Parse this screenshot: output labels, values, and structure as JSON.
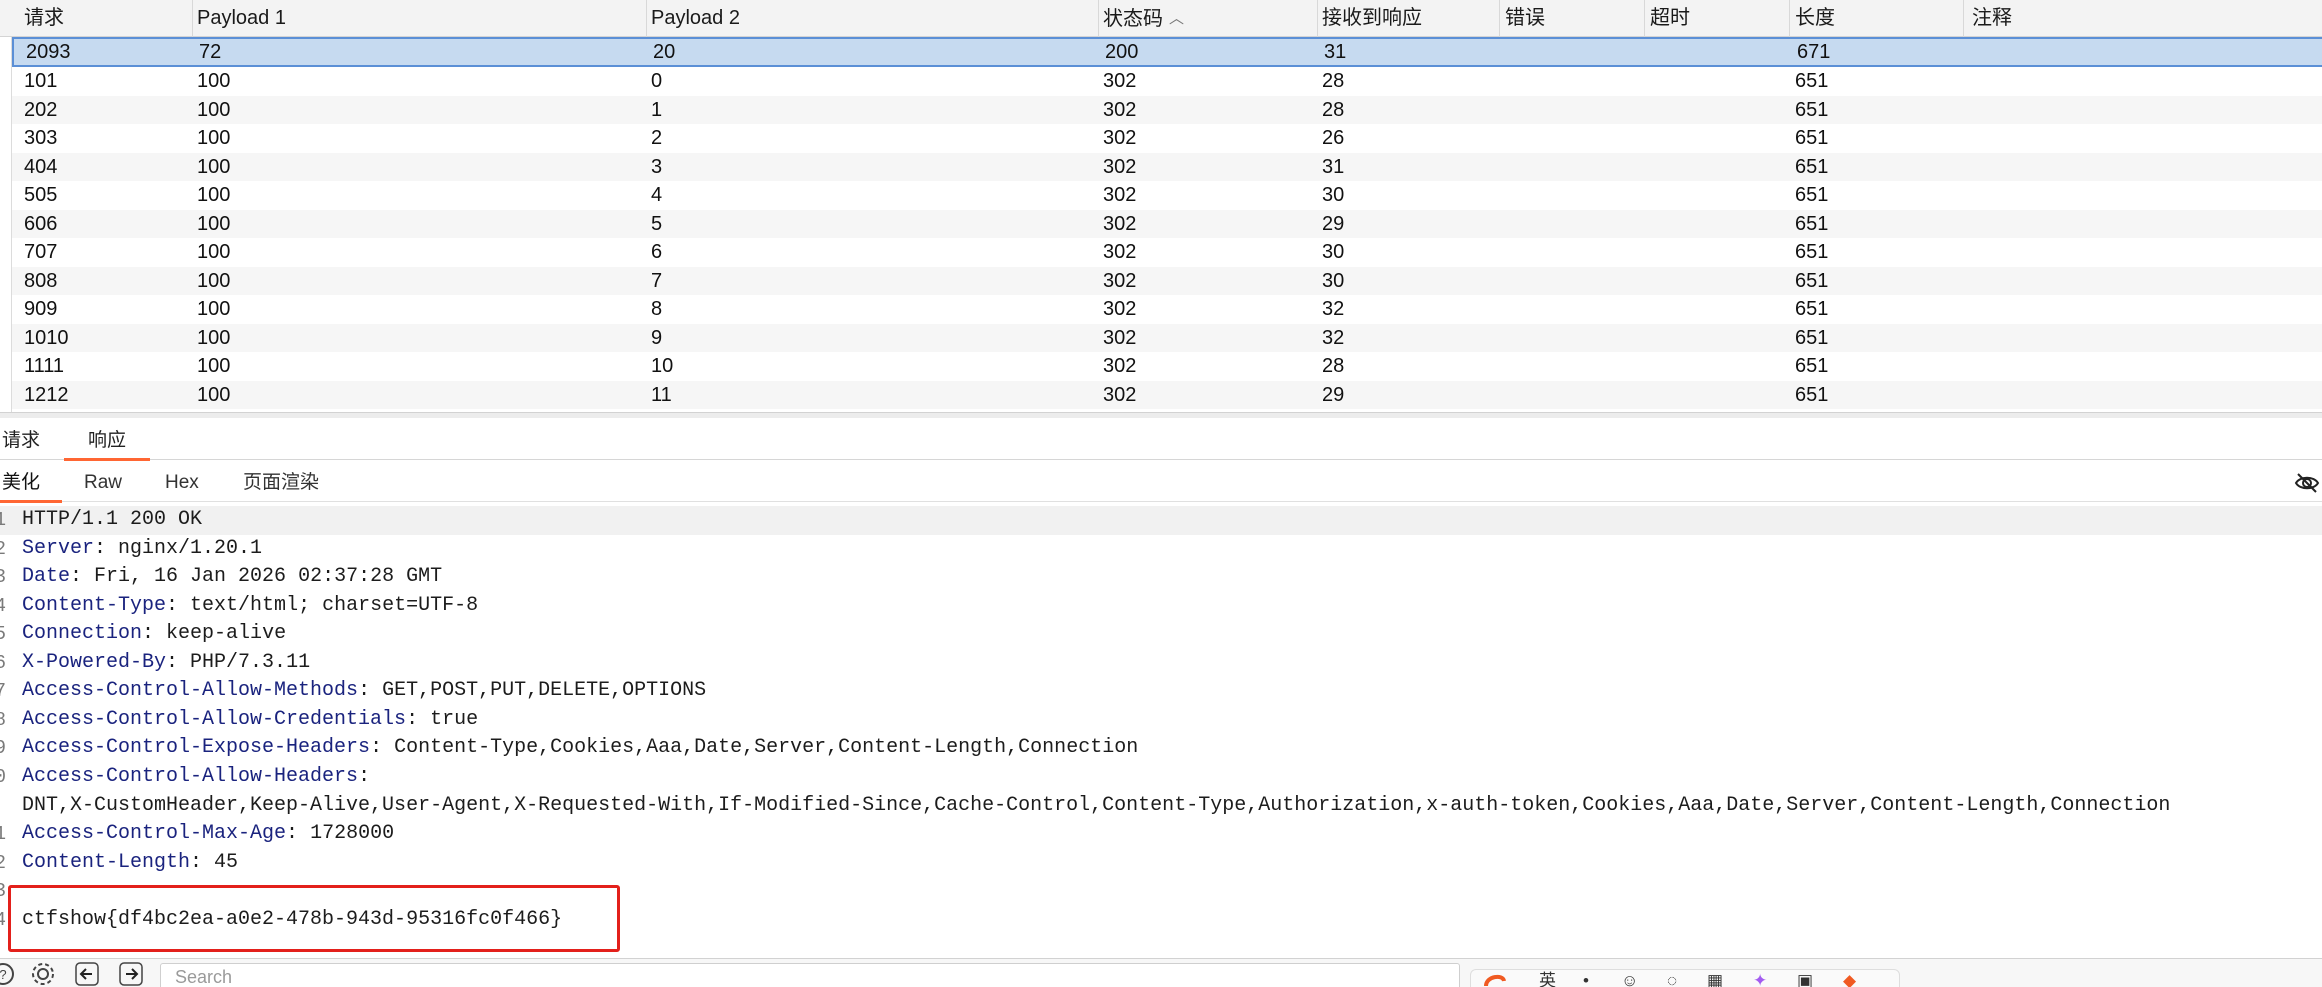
{
  "table": {
    "columns": [
      "请求",
      "Payload 1",
      "Payload 2",
      "状态码",
      "接收到响应",
      "错误",
      "超时",
      "长度",
      "注释"
    ],
    "sort_column": "状态码",
    "rows": [
      {
        "req": "2093",
        "p1": "72",
        "p2": "20",
        "status": "200",
        "recv": "31",
        "err": "",
        "timeout": "",
        "len": "671",
        "note": ""
      },
      {
        "req": "101",
        "p1": "100",
        "p2": "0",
        "status": "302",
        "recv": "28",
        "err": "",
        "timeout": "",
        "len": "651",
        "note": ""
      },
      {
        "req": "202",
        "p1": "100",
        "p2": "1",
        "status": "302",
        "recv": "28",
        "err": "",
        "timeout": "",
        "len": "651",
        "note": ""
      },
      {
        "req": "303",
        "p1": "100",
        "p2": "2",
        "status": "302",
        "recv": "26",
        "err": "",
        "timeout": "",
        "len": "651",
        "note": ""
      },
      {
        "req": "404",
        "p1": "100",
        "p2": "3",
        "status": "302",
        "recv": "31",
        "err": "",
        "timeout": "",
        "len": "651",
        "note": ""
      },
      {
        "req": "505",
        "p1": "100",
        "p2": "4",
        "status": "302",
        "recv": "30",
        "err": "",
        "timeout": "",
        "len": "651",
        "note": ""
      },
      {
        "req": "606",
        "p1": "100",
        "p2": "5",
        "status": "302",
        "recv": "29",
        "err": "",
        "timeout": "",
        "len": "651",
        "note": ""
      },
      {
        "req": "707",
        "p1": "100",
        "p2": "6",
        "status": "302",
        "recv": "30",
        "err": "",
        "timeout": "",
        "len": "651",
        "note": ""
      },
      {
        "req": "808",
        "p1": "100",
        "p2": "7",
        "status": "302",
        "recv": "30",
        "err": "",
        "timeout": "",
        "len": "651",
        "note": ""
      },
      {
        "req": "909",
        "p1": "100",
        "p2": "8",
        "status": "302",
        "recv": "32",
        "err": "",
        "timeout": "",
        "len": "651",
        "note": ""
      },
      {
        "req": "1010",
        "p1": "100",
        "p2": "9",
        "status": "302",
        "recv": "32",
        "err": "",
        "timeout": "",
        "len": "651",
        "note": ""
      },
      {
        "req": "1111",
        "p1": "100",
        "p2": "10",
        "status": "302",
        "recv": "28",
        "err": "",
        "timeout": "",
        "len": "651",
        "note": ""
      },
      {
        "req": "1212",
        "p1": "100",
        "p2": "11",
        "status": "302",
        "recv": "29",
        "err": "",
        "timeout": "",
        "len": "651",
        "note": ""
      }
    ]
  },
  "rr_tabs": {
    "request": "请求",
    "response": "响应",
    "active": "响应"
  },
  "view_tabs": {
    "pretty": "美化",
    "raw": "Raw",
    "hex": "Hex",
    "render": "页面渲染",
    "active": "美化"
  },
  "response": {
    "lines": [
      {
        "num": "1",
        "key": "",
        "sep": "",
        "val": "HTTP/1.1 200 OK"
      },
      {
        "num": "2",
        "key": "Server",
        "sep": ": ",
        "val": "nginx/1.20.1"
      },
      {
        "num": "3",
        "key": "Date",
        "sep": ": ",
        "val": "Fri, 16 Jan 2026 02:37:28 GMT"
      },
      {
        "num": "4",
        "key": "Content-Type",
        "sep": ": ",
        "val": "text/html; charset=UTF-8"
      },
      {
        "num": "5",
        "key": "Connection",
        "sep": ": ",
        "val": "keep-alive"
      },
      {
        "num": "6",
        "key": "X-Powered-By",
        "sep": ": ",
        "val": "PHP/7.3.11"
      },
      {
        "num": "7",
        "key": "Access-Control-Allow-Methods",
        "sep": ": ",
        "val": "GET,POST,PUT,DELETE,OPTIONS"
      },
      {
        "num": "8",
        "key": "Access-Control-Allow-Credentials",
        "sep": ": ",
        "val": "true"
      },
      {
        "num": "9",
        "key": "Access-Control-Expose-Headers",
        "sep": ": ",
        "val": "Content-Type,Cookies,Aaa,Date,Server,Content-Length,Connection"
      },
      {
        "num": "0",
        "key": "Access-Control-Allow-Headers",
        "sep": ":",
        "val": ""
      },
      {
        "num": "",
        "key": "",
        "sep": "",
        "val": "DNT,X-CustomHeader,Keep-Alive,User-Agent,X-Requested-With,If-Modified-Since,Cache-Control,Content-Type,Authorization,x-auth-token,Cookies,Aaa,Date,Server,Content-Length,Connection"
      },
      {
        "num": "1",
        "key": "Access-Control-Max-Age",
        "sep": ": ",
        "val": "1728000"
      },
      {
        "num": "2",
        "key": "Content-Length",
        "sep": ": ",
        "val": "45"
      },
      {
        "num": "3",
        "key": "",
        "sep": "",
        "val": ""
      },
      {
        "num": "4",
        "key": "",
        "sep": "",
        "val": "ctfshow{df4bc2ea-a0e2-478b-943d-95316fc0f466}"
      }
    ]
  },
  "search": {
    "placeholder": "Search"
  },
  "tray": {
    "ime": "英"
  },
  "colors": {
    "accent": "#ff6633",
    "selection": "#c6daf0",
    "header_key": "#1a237e",
    "highlight_box": "#e3201b"
  }
}
